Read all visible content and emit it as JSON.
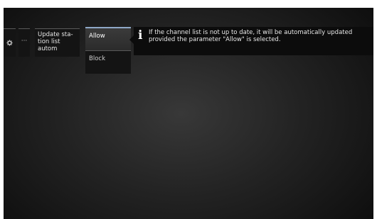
{
  "menu": {
    "settings_icon": "gear-icon",
    "more_label": "···",
    "update_item_label": "Update sta- tion list autom"
  },
  "options": [
    {
      "label": "Allow",
      "selected": true
    },
    {
      "label": "Block",
      "selected": false
    }
  ],
  "info": {
    "icon": "info-icon",
    "text": "If the channel list is not up to date, it will be automatically updated provided the parameter \"Allow\" is selected."
  },
  "colors": {
    "selection_accent": "#8fa8c8",
    "background": "#232323"
  }
}
